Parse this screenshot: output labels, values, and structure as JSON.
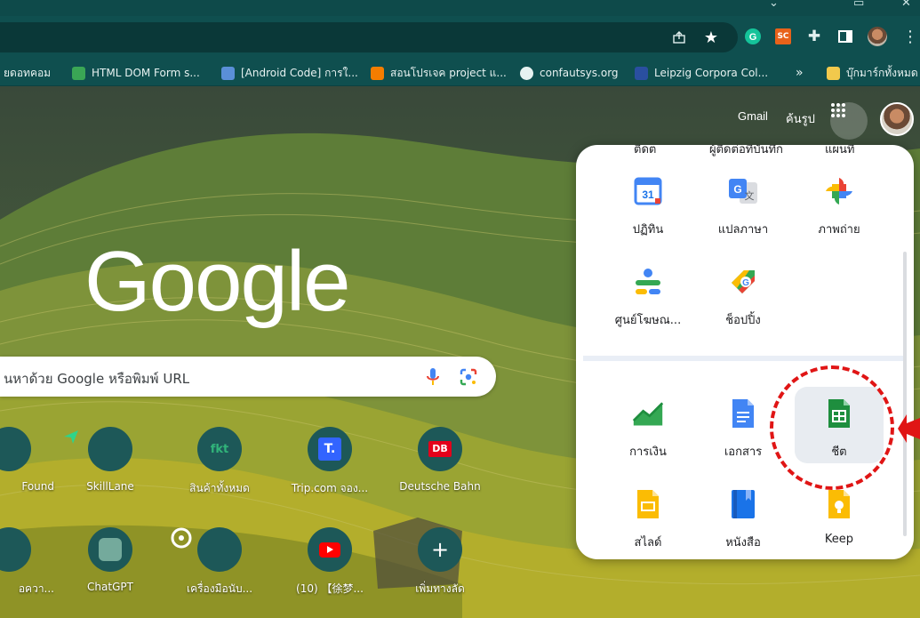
{
  "bookmarks": [
    {
      "label": "ยดอทคอม"
    },
    {
      "label": "HTML DOM Form s..."
    },
    {
      "label": "[Android Code] การใ..."
    },
    {
      "label": "สอนโปรเจค project แ..."
    },
    {
      "label": "confautsys.org"
    },
    {
      "label": "Leipzig Corpora Col..."
    },
    {
      "label": "»"
    },
    {
      "label": "บุ๊กมาร์กทั้งหมด"
    }
  ],
  "toolbar": {
    "ext_sc_label": "SC"
  },
  "header": {
    "gmail": "Gmail",
    "images": "ค้นรูป"
  },
  "logo": "Google",
  "search": {
    "placeholder": "นหาด้วย Google หรือพิมพ์ URL"
  },
  "shortcuts": [
    {
      "label": "Found"
    },
    {
      "label": "SkillLane"
    },
    {
      "label": "สินค้าทั้งหมด"
    },
    {
      "label": "Trip.com จอง..."
    },
    {
      "label": "Deutsche Bahn"
    },
    {
      "label": "อควา..."
    },
    {
      "label": "ChatGPT"
    },
    {
      "label": "เครื่องมือนับ..."
    },
    {
      "label": "(10) 【徐梦..."
    },
    {
      "label": "เพิ่มทางลัด"
    }
  ],
  "shortcut_badges": {
    "fkt": "fkt",
    "trip": "T.",
    "db": "DB"
  },
  "apps_top": [
    {
      "label": "ปฏิทิน",
      "icon": "calendar-icon",
      "badge": "31"
    },
    {
      "label": "แปลภาษา",
      "icon": "translate-icon"
    },
    {
      "label": "ภาพถ่าย",
      "icon": "photos-icon"
    },
    {
      "label": "ศูนย์โฆษณ...",
      "icon": "ads-icon"
    },
    {
      "label": "ช็อปปิ้ง",
      "icon": "shopping-icon"
    }
  ],
  "apps_bottom": [
    {
      "label": "การเงิน",
      "icon": "finance-icon"
    },
    {
      "label": "เอกสาร",
      "icon": "docs-icon"
    },
    {
      "label": "ชีต",
      "icon": "sheets-icon",
      "highlighted": true
    },
    {
      "label": "สไลด์",
      "icon": "slides-icon"
    },
    {
      "label": "หนังสือ",
      "icon": "books-icon"
    },
    {
      "label": "Keep",
      "icon": "keep-icon"
    }
  ],
  "colors": {
    "annotation": "#e01515",
    "sheets": "#1e8e3e",
    "docs": "#4285f4",
    "slides": "#fbbc04",
    "chrome_toolbar": "#0f4f4f"
  }
}
